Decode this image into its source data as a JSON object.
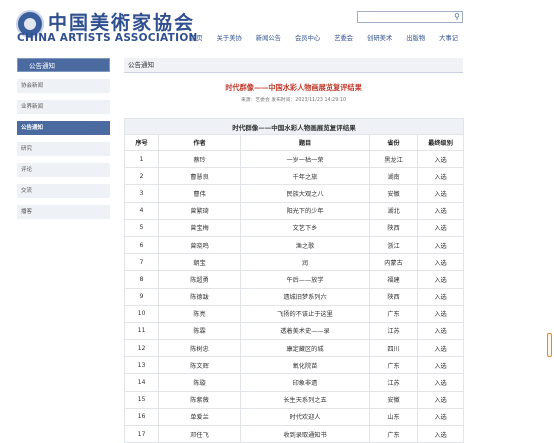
{
  "header": {
    "logo_cn": "中国美術家協会",
    "logo_en": "CHINA ARTISTS ASSOCIATION",
    "search": {
      "placeholder": "",
      "button_icon": "search-icon"
    },
    "nav": [
      "首页",
      "关于美协",
      "新闻公告",
      "会员中心",
      "艺委会",
      "创研美术",
      "出版物",
      "大事记"
    ]
  },
  "sidebar": {
    "title": "公告通知",
    "items": [
      {
        "label": "协会新闻",
        "active": false
      },
      {
        "label": "业界新闻",
        "active": false
      },
      {
        "label": "公告通知",
        "active": true
      },
      {
        "label": "研究",
        "active": false
      },
      {
        "label": "评论",
        "active": false
      },
      {
        "label": "交流",
        "active": false
      },
      {
        "label": "播客",
        "active": false
      }
    ]
  },
  "main": {
    "section_title": "公告通知",
    "article": {
      "title": "时代群像——中国水彩人物画展览复评结果",
      "meta": "来源：艺委会  发布时间：2023/11/23 14:29:10"
    },
    "table": {
      "caption": "时代群像——中国水彩人物画展览复评结果",
      "headers": [
        "序号",
        "作者",
        "题目",
        "省份",
        "最终级别"
      ],
      "rows": [
        [
          "1",
          "蔡玲",
          "一岁一枯一荣",
          "黑龙江",
          "入选"
        ],
        [
          "2",
          "曹慧良",
          "千年之旅",
          "湖南",
          "入选"
        ],
        [
          "3",
          "曹伟",
          "民族大观之八",
          "安徽",
          "入选"
        ],
        [
          "4",
          "曾繁琦",
          "阳光下的少年",
          "湖北",
          "入选"
        ],
        [
          "5",
          "曾宝梅",
          "文艺下乡",
          "陕西",
          "入选"
        ],
        [
          "6",
          "曾晓鸣",
          "渔之歌",
          "浙江",
          "入选"
        ],
        [
          "7",
          "朝宝",
          "润",
          "内蒙古",
          "入选"
        ],
        [
          "8",
          "陈超勇",
          "午后——放学",
          "福建",
          "入选"
        ],
        [
          "9",
          "陈德跋",
          "遗城旧梦系列六",
          "陕西",
          "入选"
        ],
        [
          "10",
          "陈亮",
          "飞扬的不该止于这里",
          "广东",
          "入选"
        ],
        [
          "11",
          "陈霖",
          "透着美术史——录",
          "江苏",
          "入选"
        ],
        [
          "12",
          "陈树忠",
          "康定藏区的城",
          "四川",
          "入选"
        ],
        [
          "13",
          "陈文辉",
          "氧化院苗",
          "广东",
          "入选"
        ],
        [
          "14",
          "陈璇",
          "印象非遗",
          "江苏",
          "入选"
        ],
        [
          "15",
          "陈紫薇",
          "长生天系列之五",
          "安徽",
          "入选"
        ],
        [
          "16",
          "单爱兰",
          "时代欢迎人",
          "山东",
          "入选"
        ],
        [
          "17",
          "邓任飞",
          "收到录取通知书",
          "广东",
          "入选"
        ]
      ]
    }
  },
  "colors": {
    "brand_blue": "#2f4f8f",
    "sidebar_active": "#4a6aa0",
    "title_red": "#c0392b"
  }
}
